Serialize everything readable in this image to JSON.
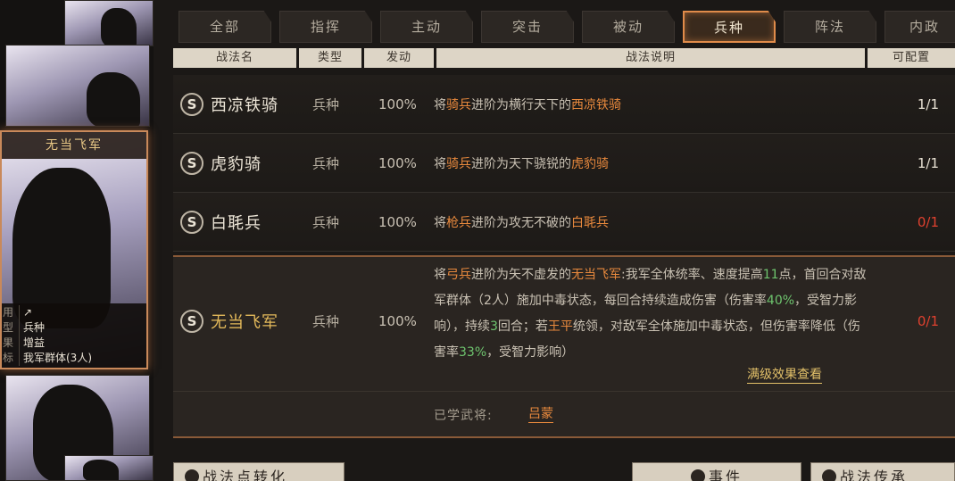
{
  "tabs": [
    "全部",
    "指挥",
    "主动",
    "突击",
    "被动",
    "兵种",
    "阵法",
    "内政"
  ],
  "active_tab": "兵种",
  "headers": {
    "name": "战法名",
    "type": "类型",
    "rate": "发动",
    "desc": "战法说明",
    "cap": "可配置"
  },
  "selected_card": {
    "title": "无当飞军",
    "info": [
      {
        "key": "用",
        "val": "↗"
      },
      {
        "key": "型",
        "val": "兵种"
      },
      {
        "key": "果",
        "val": "增益"
      },
      {
        "key": "标",
        "val": "我军群体(3人)"
      }
    ]
  },
  "rows": [
    {
      "grade": "S",
      "name": "西凉铁骑",
      "type": "兵种",
      "rate": "100%",
      "desc_pre": "将",
      "desc_h1": "骑兵",
      "desc_mid": "进阶为横行天下的",
      "desc_h2": "西凉铁骑",
      "cap": "1/1",
      "cap_red": false
    },
    {
      "grade": "S",
      "name": "虎豹骑",
      "type": "兵种",
      "rate": "100%",
      "desc_pre": "将",
      "desc_h1": "骑兵",
      "desc_mid": "进阶为天下骁锐的",
      "desc_h2": "虎豹骑",
      "cap": "1/1",
      "cap_red": false
    },
    {
      "grade": "S",
      "name": "白毦兵",
      "type": "兵种",
      "rate": "100%",
      "desc_pre": "将",
      "desc_h1": "枪兵",
      "desc_mid": "进阶为攻无不破的",
      "desc_h2": "白毦兵",
      "cap": "0/1",
      "cap_red": true
    }
  ],
  "expanded": {
    "grade": "S",
    "name": "无当飞军",
    "type": "兵种",
    "rate": "100%",
    "cap": "0/1",
    "d1": "将",
    "d1h": "弓兵",
    "d2": "进阶为矢不虚发的",
    "d2h": "无当飞军",
    "d3": ":我军全体统率、速度提高",
    "d3n": "11",
    "d4": "点，首回合对敌军群体（2人）施加中毒状态，每回合持续造成伤害（伤害率",
    "d4n": "40%",
    "d5": "，受智力影响），持续",
    "d5n": "3",
    "d6": "回合；若",
    "d6h": "王平",
    "d7": "统领，对敌军全体施加中毒状态，但伤害率降低（伤害率",
    "d7n": "33%",
    "d8": "，受智力影响）",
    "full_effect": "满级效果查看",
    "learned_label": "已学武将:",
    "learned_val": "吕蒙"
  },
  "buttons": {
    "convert": "战法点转化",
    "event": "事件",
    "inherit": "战法传承"
  }
}
